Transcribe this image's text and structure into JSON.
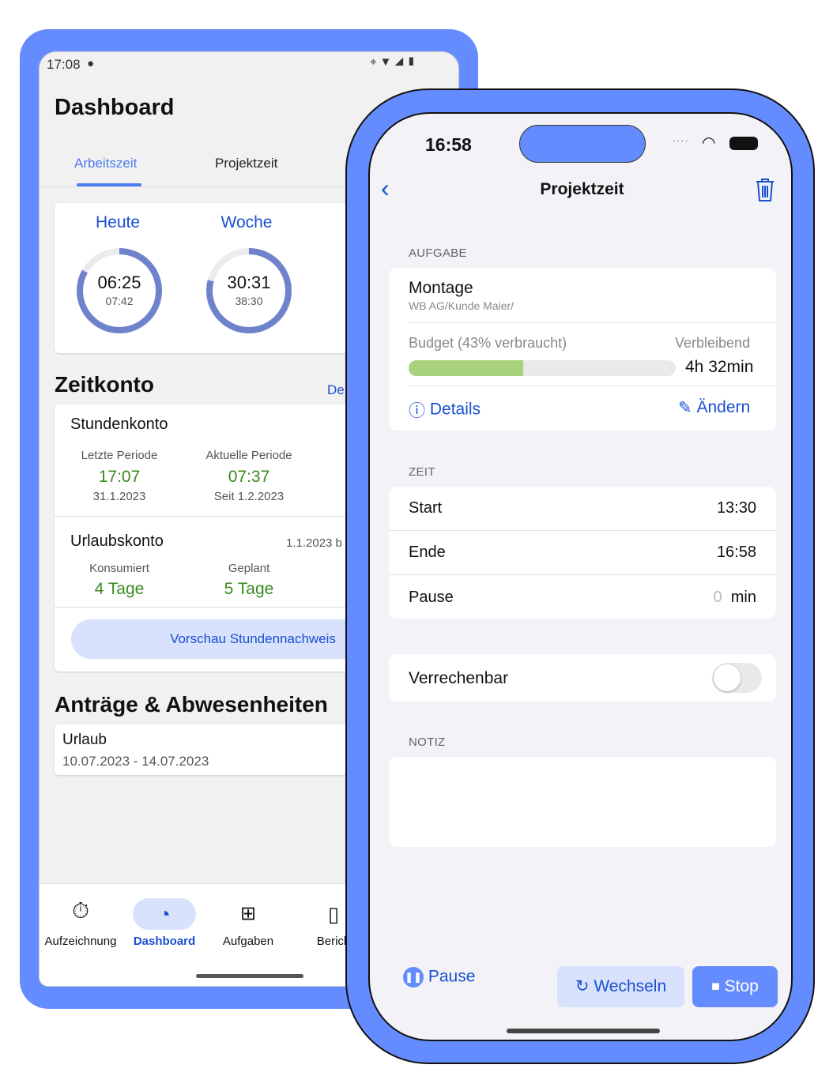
{
  "android": {
    "status_time": "17:08",
    "title": "Dashboard",
    "tabs": [
      {
        "label": "Arbeitszeit",
        "active": true
      },
      {
        "label": "Projektzeit",
        "active": false
      }
    ],
    "rings": [
      {
        "label": "Heute",
        "value": "06:25",
        "target": "07:42",
        "progress": 0.83
      },
      {
        "label": "Woche",
        "value": "30:31",
        "target": "38:30",
        "progress": 0.79
      }
    ],
    "zeitkonto": {
      "title": "Zeitkonto",
      "link": "De",
      "stundenkonto": {
        "title": "Stundenkonto",
        "last_label": "Letzte Periode",
        "last_value": "17:07",
        "last_date": "31.1.2023",
        "cur_label": "Aktuelle Periode",
        "cur_value": "07:37",
        "cur_date": "Seit 1.2.2023"
      },
      "urlaubskonto": {
        "title": "Urlaubskonto",
        "date": "1.1.2023 b",
        "used_label": "Konsumiert",
        "used_value": "4 Tage",
        "plan_label": "Geplant",
        "plan_value": "5 Tage"
      },
      "preview_button": "Vorschau Stundennachweis"
    },
    "requests": {
      "title": "Anträge & Abwesenheiten",
      "items": [
        {
          "type": "Urlaub",
          "range": "10.07.2023 - 14.07.2023"
        }
      ]
    },
    "nav": [
      {
        "label": "Aufzeichnung",
        "icon": "stopwatch-icon"
      },
      {
        "label": "Dashboard",
        "icon": "pie-chart-icon",
        "active": true
      },
      {
        "label": "Aufgaben",
        "icon": "hierarchy-icon"
      },
      {
        "label": "Berich",
        "icon": "report-icon"
      }
    ],
    "accent": "#1a4fd0"
  },
  "ios": {
    "status_time": "16:58",
    "title": "Projektzeit",
    "aufgabe": {
      "section": "AUFGABE",
      "name": "Montage",
      "path": "WB AG/Kunde Maier/",
      "budget_label": "Budget (43% verbraucht)",
      "budget_used": 0.43,
      "remaining_label": "Verbleibend",
      "remaining_value": "4h 32min",
      "details": "Details",
      "edit": "Ändern"
    },
    "zeit": {
      "section": "ZEIT",
      "rows": [
        {
          "label": "Start",
          "value": "13:30"
        },
        {
          "label": "Ende",
          "value": "16:58"
        },
        {
          "label": "Pause",
          "value": "0",
          "unit": "min"
        }
      ]
    },
    "billable": {
      "label": "Verrechenbar",
      "on": false
    },
    "notiz": {
      "section": "NOTIZ",
      "value": ""
    },
    "actions": {
      "pause": "Pause",
      "switch": "Wechseln",
      "stop": "Stop"
    },
    "accent": "#658cff"
  }
}
